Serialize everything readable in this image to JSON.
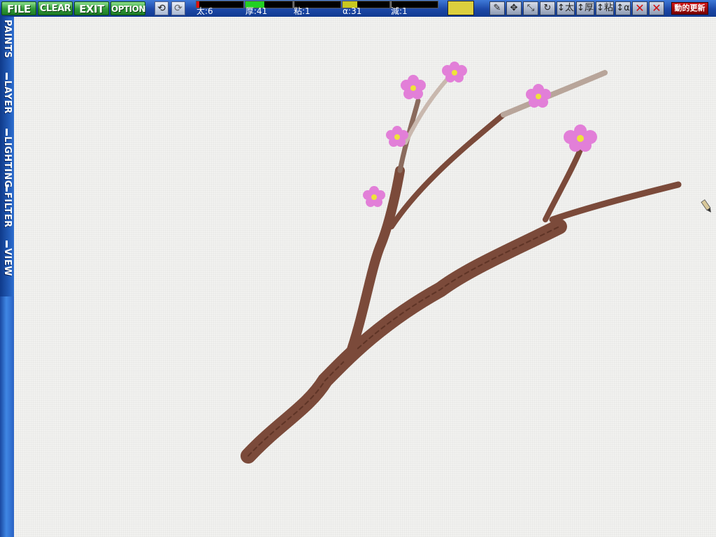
{
  "menu": {
    "file": "FILE",
    "clear": "CLEAR",
    "exit": "EXIT",
    "option": "OPTION"
  },
  "toolbar": {
    "undo_icon": "undo-icon",
    "redo_icon": "redo-icon",
    "sliders": [
      {
        "label": "太:6",
        "value": 6,
        "color": "#e01010"
      },
      {
        "label": "厚:41",
        "value": 41,
        "color": "#22d022"
      },
      {
        "label": "粘:1",
        "value": 1,
        "color": "#8a8a8a"
      },
      {
        "label": "α:31",
        "value": 31,
        "color": "#c8c820"
      },
      {
        "label": "減:1",
        "value": 1,
        "color": "#8a8a8a"
      }
    ],
    "current_color": "#dccf3e",
    "icons": {
      "brush": "brush-icon",
      "move": "move-icon",
      "resize": "resize-icon",
      "rotate": "rotate-icon",
      "size_label": "↕太",
      "thick_label": "↕厚",
      "sticky_label": "↕粘",
      "alpha_label": "↕α",
      "cross1": "✕",
      "cross2": "✕"
    },
    "refresh": "動的更新"
  },
  "side_tabs": [
    "PAINTS",
    "LAYER",
    "LIGHTING",
    "FILTER",
    "VIEW"
  ],
  "colors": {
    "branch": "#7b4a3a",
    "blossom": "#e27fd8",
    "blossom_center": "#efe33a"
  }
}
